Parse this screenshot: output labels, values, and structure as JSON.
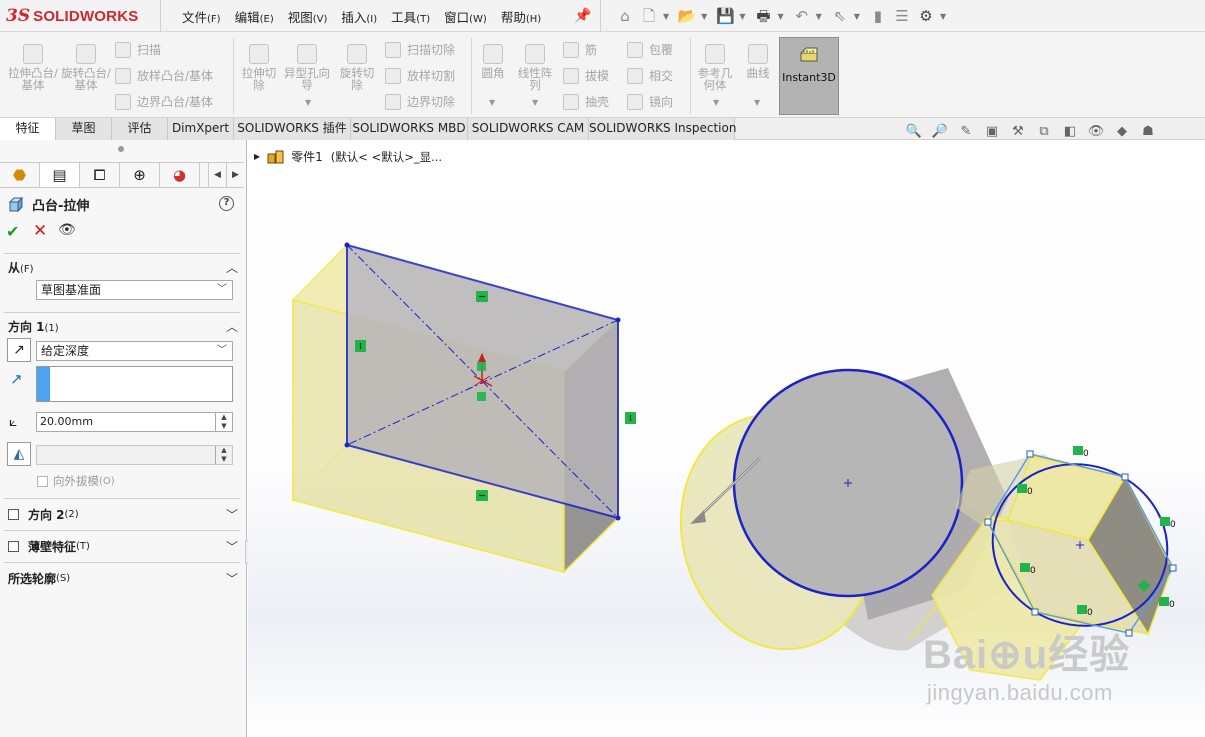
{
  "app": {
    "logo_prefix": "3S",
    "logo_text": "SOLIDWORKS"
  },
  "menu": [
    {
      "label": "文件",
      "key": "(F)"
    },
    {
      "label": "编辑",
      "key": "(E)"
    },
    {
      "label": "视图",
      "key": "(V)"
    },
    {
      "label": "插入",
      "key": "(I)"
    },
    {
      "label": "工具",
      "key": "(T)"
    },
    {
      "label": "窗口",
      "key": "(W)"
    },
    {
      "label": "帮助",
      "key": "(H)"
    }
  ],
  "quick_access": [
    "home-icon",
    "new-icon",
    "open-icon",
    "save-icon",
    "print-icon",
    "undo-icon",
    "select-icon",
    "rebuild-icon",
    "file-properties-icon",
    "options-icon"
  ],
  "ribbon": {
    "extrude_boss": "拉伸凸台/基体",
    "revolve_boss": "旋转凸台/基体",
    "sweep": "扫描",
    "loft_boss": "放样凸台/基体",
    "boundary_boss": "边界凸台/基体",
    "extrude_cut": "拉伸切除",
    "hole_wizard": "异型孔向导",
    "revolve_cut": "旋转切除",
    "sweep_cut": "扫描切除",
    "loft_cut": "放样切割",
    "boundary_cut": "边界切除",
    "fillet": "圆角",
    "linear_pattern": "线性阵列",
    "rib": "筋",
    "draft": "拔模",
    "shell": "抽壳",
    "wrap": "包覆",
    "intersect": "相交",
    "mirror": "镜向",
    "ref_geometry": "参考几何体",
    "curves": "曲线",
    "instant3d": "Instant3D"
  },
  "command_tabs": [
    "特征",
    "草图",
    "评估",
    "DimXpert",
    "SOLIDWORKS 插件",
    "SOLIDWORKS MBD",
    "SOLIDWORKS CAM",
    "SOLIDWORKS Inspection"
  ],
  "active_tab": "特征",
  "tree": {
    "part_name": "零件1",
    "config": "(默认< <默认>_显..."
  },
  "property_manager": {
    "title": "凸台-拉伸",
    "from_section": {
      "label": "从",
      "key": "(F)",
      "value": "草图基准面"
    },
    "direction1": {
      "label": "方向 1",
      "key": "(1)",
      "end_condition": "给定深度",
      "depth": "20.00mm",
      "draft_value": "",
      "draft_outward": "向外拔模",
      "draft_key": "(O)"
    },
    "direction2": {
      "label": "方向 2",
      "key": "(2)"
    },
    "thin_feature": {
      "label": "薄壁特征",
      "key": "(T)"
    },
    "selected_contours": {
      "label": "所选轮廓",
      "key": "(S)"
    }
  },
  "colors": {
    "sketch_line": "#1a22c8",
    "preview_fill": "#efeaa8",
    "preview_edge": "#f2e83a",
    "relation_badge": "#22b34a",
    "panel_bg": "#f7f7f7",
    "instant3d_active": "#b3b3b3"
  },
  "watermark": {
    "logo": "Bai⊕u经验",
    "url": "jingyan.baidu.com"
  }
}
